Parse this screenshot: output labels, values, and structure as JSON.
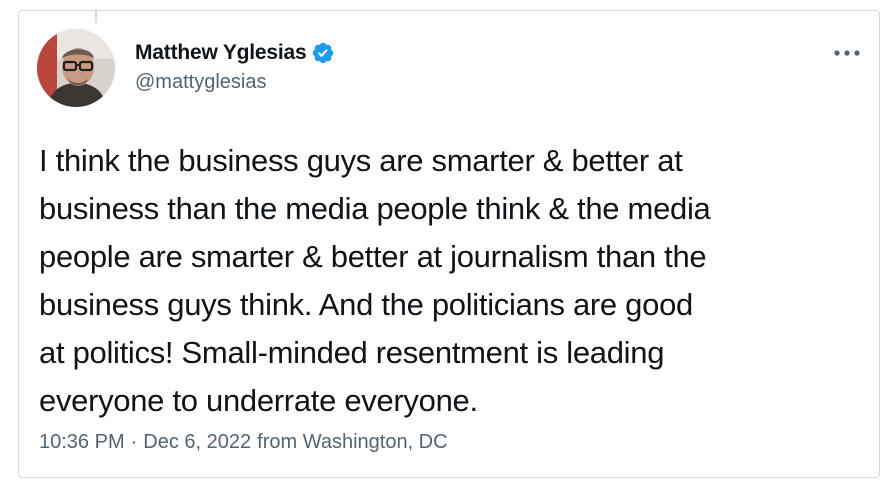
{
  "tweet": {
    "author": {
      "display_name": "Matthew Yglesias",
      "handle": "@mattyglesias",
      "verified": true,
      "avatar_icon": "profile-photo"
    },
    "text": "I think the business guys are smarter & better at\nbusiness than the media people think & the media\npeople are smarter & better at journalism than the\nbusiness guys think. And the politicians are good\nat politics! Small-minded resentment is leading\neveryone to underrate everyone.",
    "time": "10:36 PM",
    "separator": "·",
    "date": "Dec 6, 2022",
    "location": "from Washington, DC"
  },
  "icons": {
    "verified": "verified-badge-icon",
    "more": "more-horizontal-icon"
  },
  "colors": {
    "text_primary": "#0f1419",
    "text_secondary": "#536471",
    "verified_blue": "#1d9bf0",
    "border": "#cfd9de"
  }
}
